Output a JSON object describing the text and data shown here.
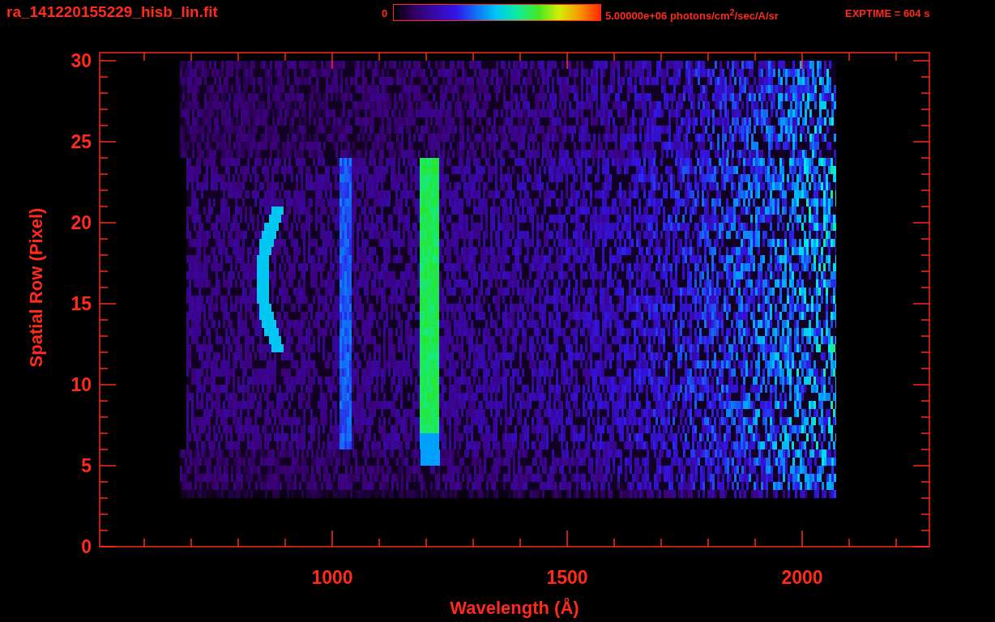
{
  "title": "ra_141220155229_hisb_lin.fit",
  "colorbar": {
    "min_label": "0",
    "max_label": "5.00000e+06 photons/cm$^{2}$/sec/A/sr"
  },
  "exposure": "EXPTIME = 604 s",
  "y_axis": {
    "label": "Spatial Row (Pixel)",
    "ticks": [
      "30",
      "25",
      "20",
      "15",
      "10",
      "5",
      "0"
    ]
  },
  "x_axis": {
    "label": "Wavelength (Å)",
    "ticks": [
      "1000",
      "1500",
      "2000"
    ]
  }
}
